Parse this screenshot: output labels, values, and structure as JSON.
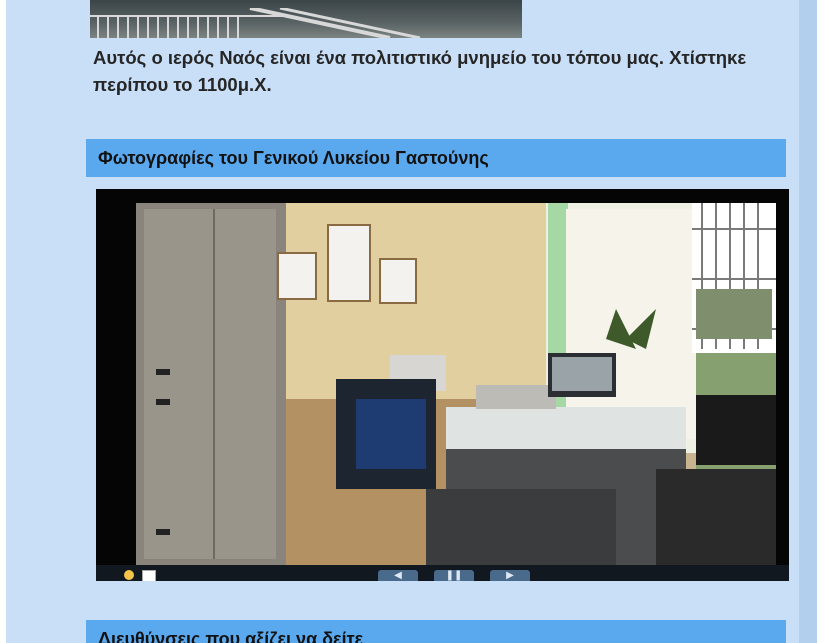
{
  "article": {
    "caption": "Αυτός ο ιερός Ναός είναι ένα πολιτιστικό μνημείο του τόπου μας. Χτίστηκε περίπου το 1100μ.Χ."
  },
  "photos_section": {
    "heading": "Φωτογραφίες του Γενικού Λυκείου Γαστούνης"
  },
  "slideshow": {
    "prev_icon": "previous-icon",
    "pause_icon": "pause-icon",
    "next_icon": "next-icon",
    "info_icon": "info-icon",
    "thumbnails_icon": "thumbnails-icon",
    "prev_glyph": "◀",
    "pause_glyph": "❚❚",
    "next_glyph": "▶"
  },
  "links_section": {
    "heading": "Διευθύνσεις που αξίζει να δείτε"
  },
  "colors": {
    "panel": "#c9dff7",
    "heading_bar": "#5aa9ef",
    "text": "#262626"
  }
}
